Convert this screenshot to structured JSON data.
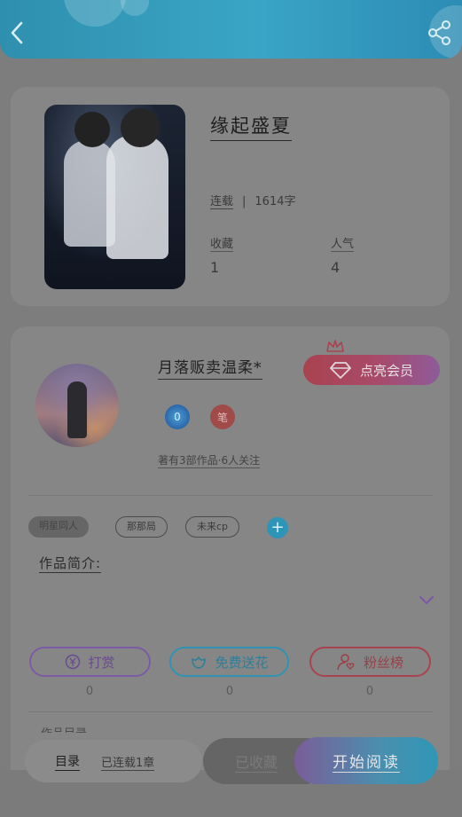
{
  "header": {
    "back_icon": "chevron-left-icon",
    "share_icon": "share-icon",
    "color": "#2f8fae"
  },
  "book": {
    "title": "缘起盛夏",
    "status": "连载",
    "word_count": "1614字",
    "favorites_label": "收藏",
    "favorites_value": "1",
    "popularity_label": "人气",
    "popularity_value": "4"
  },
  "author": {
    "name": "月落贩卖温柔*",
    "vip_button": "点亮会员",
    "badge_blue": "0",
    "badge_red": "笔",
    "works": "著有3部作品·6人关注"
  },
  "tags": [
    "明星同人",
    "那那局",
    "未来cp"
  ],
  "intro_label": "作品简介:",
  "actions": [
    {
      "label": "打赏",
      "icon": "yen-icon",
      "count": "0"
    },
    {
      "label": "免费送花",
      "icon": "flower-icon",
      "count": "0"
    },
    {
      "label": "粉丝榜",
      "icon": "user-heart-icon",
      "count": "0"
    }
  ],
  "partial_text": "作品目录",
  "bottom": {
    "catalog_label": "目录",
    "catalog_status": "已连载1章",
    "favorite_button": "已收藏",
    "read_button": "开始阅读"
  },
  "colors": {
    "accent_blue": "#2f96b6",
    "accent_red": "#a8434f",
    "accent_purple": "#7d5aa6"
  }
}
